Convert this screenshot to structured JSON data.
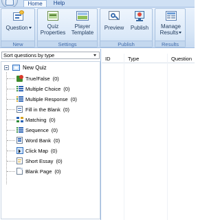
{
  "tabs": [
    {
      "label": "Home",
      "active": true
    },
    {
      "label": "Help",
      "active": false
    }
  ],
  "ribbon": {
    "groups": [
      {
        "label": "New",
        "buttons": [
          {
            "label": "Question",
            "icon": "question-icon",
            "has_dropdown": true
          }
        ]
      },
      {
        "label": "Settings",
        "buttons": [
          {
            "label": "Quiz Properties",
            "line1": "Quiz",
            "line2": "Properties",
            "icon": "quiz-properties-icon"
          },
          {
            "label": "Player Template",
            "line1": "Player",
            "line2": "Template",
            "icon": "player-template-icon"
          }
        ]
      },
      {
        "label": "Publish",
        "buttons": [
          {
            "label": "Preview",
            "icon": "preview-icon"
          },
          {
            "label": "Publish",
            "icon": "publish-icon"
          }
        ]
      },
      {
        "label": "Results",
        "buttons": [
          {
            "label": "Manage Results",
            "line1": "Manage",
            "line2": "Results",
            "icon": "manage-results-icon",
            "has_dropdown": true
          }
        ]
      }
    ]
  },
  "sort_select": {
    "value": "Sort questions by type"
  },
  "tree": {
    "root": {
      "label": "New Quiz",
      "icon": "quiz-icon",
      "expanded": true
    },
    "items": [
      {
        "label": "True/False",
        "count": "(0)",
        "icon": "true-false-icon"
      },
      {
        "label": "Multiple Choice",
        "count": "(0)",
        "icon": "multiple-choice-icon"
      },
      {
        "label": "Multiple Response",
        "count": "(0)",
        "icon": "multiple-response-icon"
      },
      {
        "label": "Fill in the Blank",
        "count": "(0)",
        "icon": "fill-blank-icon"
      },
      {
        "label": "Matching",
        "count": "(0)",
        "icon": "matching-icon"
      },
      {
        "label": "Sequence",
        "count": "(0)",
        "icon": "sequence-icon"
      },
      {
        "label": "Word Bank",
        "count": "(0)",
        "icon": "word-bank-icon"
      },
      {
        "label": "Click Map",
        "count": "(0)",
        "icon": "click-map-icon"
      },
      {
        "label": "Short Essay",
        "count": "(0)",
        "icon": "short-essay-icon"
      },
      {
        "label": "Blank Page",
        "count": "(0)",
        "icon": "blank-page-icon"
      }
    ]
  },
  "list": {
    "columns": [
      "ID",
      "Type",
      "Question"
    ]
  },
  "colors": {
    "ribbon_bg": "#dae8f8",
    "accent": "#15428b",
    "border": "#9ebbe0"
  }
}
